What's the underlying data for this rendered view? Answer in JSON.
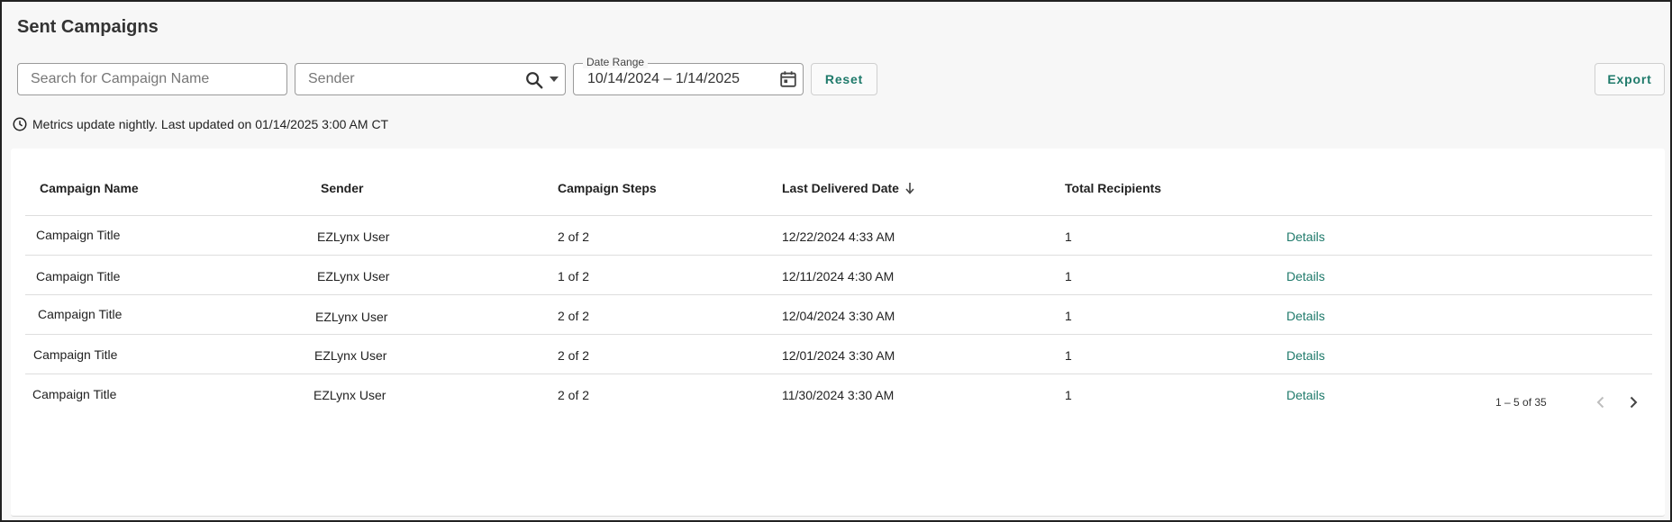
{
  "page": {
    "title": "Sent Campaigns"
  },
  "filters": {
    "search_placeholder": "Search for Campaign Name",
    "sender_placeholder": "Sender",
    "date_range_label": "Date Range",
    "date_range_value": "10/14/2024 – 1/14/2025",
    "reset_label": "Reset",
    "export_label": "Export"
  },
  "metrics_note": "Metrics update nightly. Last updated on 01/14/2025 3:00 AM CT",
  "table": {
    "columns": [
      "Campaign Name",
      "Sender",
      "Campaign Steps",
      "Last Delivered Date",
      "Total Recipients"
    ],
    "sort_column": "Last Delivered Date",
    "sort_direction": "descending",
    "rows": [
      {
        "name": "Campaign Title",
        "sender": "EZLynx User",
        "steps": "2 of 2",
        "last_delivered": "12/22/2024 4:33 AM",
        "recipients": "1",
        "action": "Details"
      },
      {
        "name": "Campaign Title",
        "sender": "EZLynx User",
        "steps": "1 of 2",
        "last_delivered": "12/11/2024 4:30 AM",
        "recipients": "1",
        "action": "Details"
      },
      {
        "name": "Campaign Title",
        "sender": "EZLynx User",
        "steps": "2 of 2",
        "last_delivered": "12/04/2024 3:30 AM",
        "recipients": "1",
        "action": "Details"
      },
      {
        "name": "Campaign Title",
        "sender": "EZLynx User",
        "steps": "2 of 2",
        "last_delivered": "12/01/2024 3:30 AM",
        "recipients": "1",
        "action": "Details"
      },
      {
        "name": "Campaign Title",
        "sender": "EZLynx User",
        "steps": "2 of 2",
        "last_delivered": "11/30/2024 3:30 AM",
        "recipients": "1",
        "action": "Details"
      }
    ]
  },
  "pagination": {
    "label": "1 – 5 of 35"
  },
  "colors": {
    "accent": "#1f7a6b",
    "divider": "#dedede",
    "background": "#f7f7f7"
  },
  "icons": {
    "search": "search-icon",
    "dropdown": "caret-down-icon",
    "calendar": "calendar-icon",
    "clock": "clock-icon",
    "sort": "arrow-down-icon",
    "prev": "chevron-left-icon",
    "next": "chevron-right-icon"
  }
}
